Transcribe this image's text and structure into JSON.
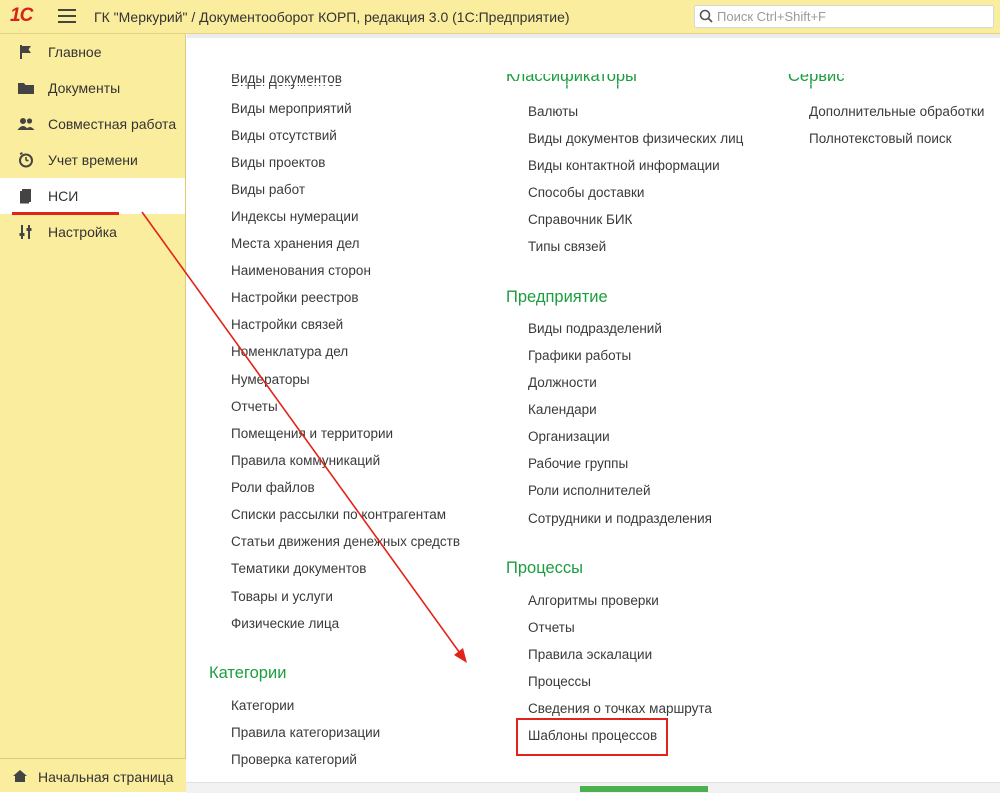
{
  "header": {
    "logo_text": "1С",
    "title": "ГК \"Меркурий\" / Документооборот КОРП, редакция 3.0  (1С:Предприятие)",
    "search_placeholder": "Поиск Ctrl+Shift+F"
  },
  "sidebar": {
    "items": [
      {
        "label": "Главное",
        "icon": "flag-icon"
      },
      {
        "label": "Документы",
        "icon": "folder-icon"
      },
      {
        "label": "Совместная работа",
        "icon": "users-icon"
      },
      {
        "label": "Учет времени",
        "icon": "clock-icon"
      },
      {
        "label": "НСИ",
        "icon": "book-icon",
        "active": true
      },
      {
        "label": "Настройка",
        "icon": "sliders-icon"
      }
    ],
    "home_label": "Начальная страница",
    "home_icon": "home-icon"
  },
  "columns": {
    "col1": {
      "clipped_header": "Виды документов",
      "items": [
        "Виды мероприятий",
        "Виды отсутствий",
        "Виды проектов",
        "Виды работ",
        "Индексы нумерации",
        "Места хранения дел",
        "Наименования сторон",
        "Настройки реестров",
        "Настройки связей",
        "Номенклатура дел",
        "Нумераторы",
        "Отчеты",
        "Помещения и территории",
        "Правила коммуникаций",
        "Роли файлов",
        "Списки рассылки по контрагентам",
        "Статьи движения денежных средств",
        "Тематики документов",
        "Товары и услуги",
        "Физические лица"
      ],
      "group2_title": "Категории",
      "group2_items": [
        "Категории",
        "Правила категоризации",
        "Проверка категорий"
      ]
    },
    "col2": {
      "clipped_header": "Классификаторы",
      "items": [
        "Валюты",
        "Виды документов физических лиц",
        "Виды контактной информации",
        "Способы доставки",
        "Справочник БИК",
        "Типы связей"
      ],
      "group2_title": "Предприятие",
      "group2_items": [
        "Виды подразделений",
        "Графики работы",
        "Должности",
        "Календари",
        "Организации",
        "Рабочие группы",
        "Роли исполнителей",
        "Сотрудники и подразделения"
      ],
      "group3_title": "Процессы",
      "group3_items": [
        "Алгоритмы проверки",
        "Отчеты",
        "Правила эскалации",
        "Процессы",
        "Сведения о точках маршрута",
        "Шаблоны процессов"
      ]
    },
    "col3": {
      "clipped_header": "Сервис",
      "items": [
        "Дополнительные обработки",
        "Полнотекстовый поиск"
      ]
    }
  },
  "colors": {
    "sidebar_bg": "#fbed9e",
    "group_title": "#1b9e3e",
    "annotation_red": "#e2231a"
  }
}
